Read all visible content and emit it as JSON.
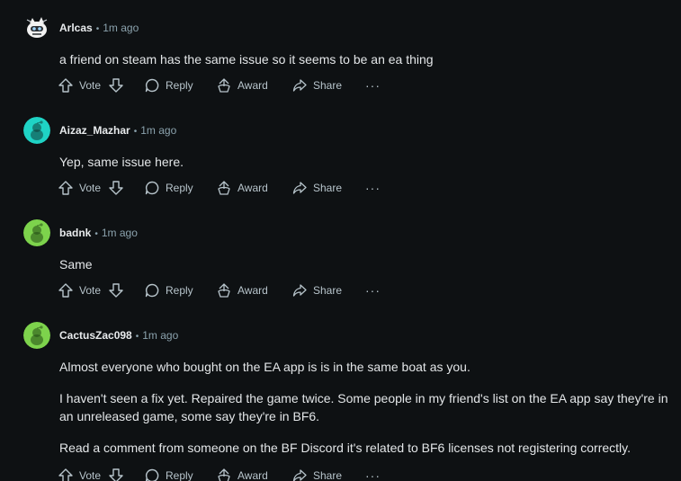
{
  "comments": [
    {
      "author": "Arlcas",
      "time": "1m ago",
      "avatar": "robot-avatar-icon",
      "paragraphs": [
        "a friend on steam has the same issue so it seems to be an ea thing"
      ]
    },
    {
      "author": "Aizaz_Mazhar",
      "time": "1m ago",
      "avatar": "snoo-avatar-icon",
      "avatar_color": "#1fd3c5",
      "paragraphs": [
        "Yep, same issue here."
      ]
    },
    {
      "author": "badnk",
      "time": "1m ago",
      "avatar": "snoo-avatar-icon",
      "avatar_color": "#7dd34c",
      "paragraphs": [
        "Same"
      ]
    },
    {
      "author": "CactusZac098",
      "time": "1m ago",
      "avatar": "snoo-avatar-icon",
      "avatar_color": "#7dd34c",
      "paragraphs": [
        "Almost everyone who bought on the EA app is is in the same boat as you.",
        "I haven't seen a fix yet. Repaired the game twice. Some people in my friend's list on the EA app say they're in an unreleased game, some say they're in BF6.",
        "Read a comment from someone on the BF Discord it's related to BF6 licenses not registering correctly."
      ]
    }
  ],
  "actions": {
    "vote": "Vote",
    "reply": "Reply",
    "award": "Award",
    "share": "Share",
    "more": "···"
  },
  "meta_separator": "•"
}
